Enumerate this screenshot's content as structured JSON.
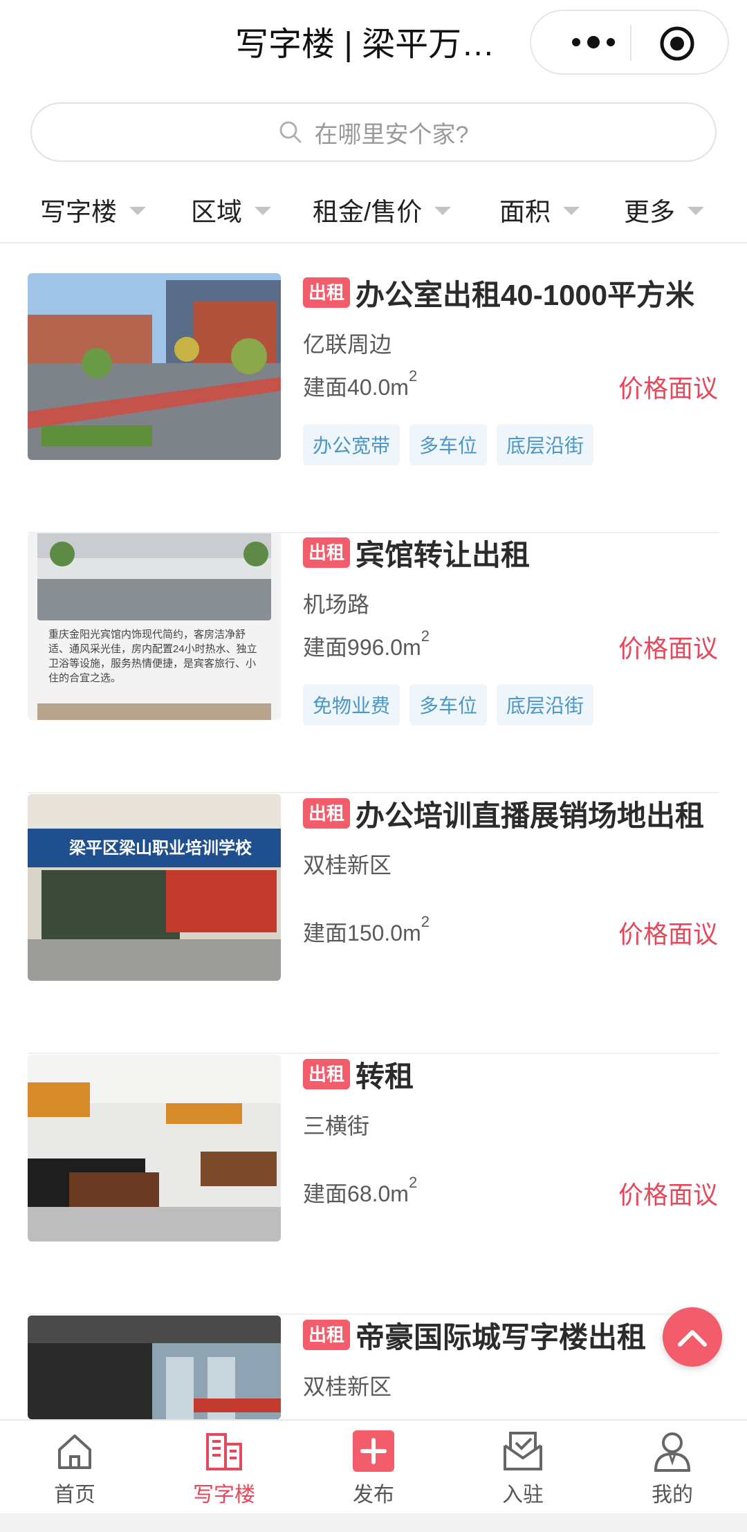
{
  "header": {
    "title": "写字楼 | 梁平万…"
  },
  "search": {
    "placeholder": "在哪里安个家?"
  },
  "filters": [
    "写字楼",
    "区域",
    "租金/售价",
    "面积",
    "更多"
  ],
  "listings": [
    {
      "badge": "出租",
      "title": "办公室出租40-1000平方米",
      "location": "亿联周边",
      "area_prefix": "建面",
      "area_value": "40.0m",
      "area_sup": "2",
      "price": "价格面议",
      "tags": [
        "办公宽带",
        "多车位",
        "底层沿街"
      ]
    },
    {
      "badge": "出租",
      "title": "宾馆转让出租",
      "location": "机场路",
      "area_prefix": "建面",
      "area_value": "996.0m",
      "area_sup": "2",
      "price": "价格面议",
      "tags": [
        "免物业费",
        "多车位",
        "底层沿街"
      ],
      "image_text": "重庆金阳光宾馆内饰现代简约，客房洁净舒适、通风采光佳，房内配置24小时热水、独立卫浴等设施，服务热情便捷，是宾客旅行、小住的合宜之选。"
    },
    {
      "badge": "出租",
      "title": "办公培训直播展销场地出租",
      "location": "双桂新区",
      "area_prefix": "建面",
      "area_value": "150.0m",
      "area_sup": "2",
      "price": "价格面议",
      "tags": [],
      "image_text": "梁平区梁山职业培训学校"
    },
    {
      "badge": "出租",
      "title": "转租",
      "location": "三横街",
      "area_prefix": "建面",
      "area_value": "68.0m",
      "area_sup": "2",
      "price": "价格面议",
      "tags": []
    },
    {
      "badge": "出租",
      "title": "帝豪国际城写字楼出租",
      "location": "双桂新区",
      "tags": []
    }
  ],
  "tabbar": [
    {
      "label": "首页",
      "icon": "home-icon",
      "active": false
    },
    {
      "label": "写字楼",
      "icon": "office-building-icon",
      "active": true
    },
    {
      "label": "发布",
      "icon": "publish-plus-icon",
      "active": false
    },
    {
      "label": "入驻",
      "icon": "check-in-icon",
      "active": false
    },
    {
      "label": "我的",
      "icon": "profile-icon",
      "active": false
    }
  ],
  "colors": {
    "accent": "#e5475b",
    "badge": "#f25c6b",
    "tag_bg": "#eef6fb",
    "tag_text": "#4b96c4"
  }
}
